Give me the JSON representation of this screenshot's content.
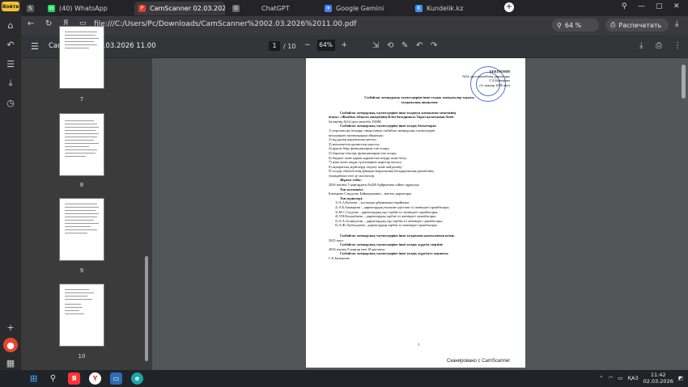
{
  "side_panel": {
    "profile_label": "Войти",
    "icons": [
      "home-icon",
      "back-icon",
      "history-icon",
      "downloads-icon",
      "clock-icon",
      "add-icon",
      "alice-icon",
      "apps-icon"
    ]
  },
  "tabs": [
    {
      "label": "",
      "favicon": "S",
      "color": "#5b5b62"
    },
    {
      "label": "(40) WhatsApp",
      "favicon": "W",
      "color": "#25d366"
    },
    {
      "label": "CamScanner 02.03.202",
      "favicon": "P",
      "color": "#e33b2e",
      "active": true
    },
    {
      "label": "ChatGPT",
      "favicon": "G",
      "color": "#6b6b6b"
    },
    {
      "label": "Google Gemini",
      "favicon": "✦",
      "color": "#4b82f5"
    },
    {
      "label": "Kundelik.kz",
      "favicon": "K",
      "color": "#3f8ef5"
    }
  ],
  "address_bar": {
    "url": "file:///C:/Users/Pc/Downloads/CamScanner%2002.03.2026%2011.00.pdf",
    "zoom": "64 %",
    "print_label": "Распечатать"
  },
  "pdf_toolbar": {
    "title": "CamScanner 02.03.2026 11.00",
    "current_page": "1",
    "total_pages": "/ 10",
    "zoom": "64%",
    "zoom_out": "−",
    "zoom_in": "+"
  },
  "thumbnails": [
    {
      "number": "7"
    },
    {
      "number": "8"
    },
    {
      "number": "9"
    },
    {
      "number": "10"
    }
  ],
  "document": {
    "approval": [
      "БЕКІТЕМІН",
      "№54 орта мектебінің директоры",
      "С.Б.Битюрова",
      "«5» қаңтар 2026 жыл"
    ],
    "title_1": "Сыбайлас жемқорлық тәуекелдеріне ішкі талдау жатқызулер туралы",
    "title_2": "талдамалық анықтама",
    "intro_1": "Сыбайлас жемқорлық тәуекелдеріне ішкі талдауға жатқызған мекеменің",
    "intro_2": "атауы: «Жамбыл облысы әкімдігінің білім басқармасы Тараз қаласының білім",
    "intro_3": "бөлімінің №54 орта мектебі» КММ.",
    "directions_heading": "Сыбайлас жемқорлық тәуекелдеріне ішкі талдау бағыттары:",
    "directions": [
      "1)    персоналды басқару, оның ішінде сыбайлас жемқорлық тәуекелдерін",
      "шалдықкан лауазымдарды айқындау;",
      "2) мүдделер қақтығысын реттеу;",
      "3) мемлекеттік қызметтер көрсету;",
      "4) рұқсат беру функцияларын іске асыру;",
      "5) бақылау-тексеру функцияларын іске асыру;",
      "6) бюджет және қаржы қаржаттын атқару және бөлу;",
      "7) жеке және заңды тұлғалармен шарттар жасасу;",
      "8) ақпараттық жүйелерді өзірлеу және пайдалану;",
      "9)    талдау    объектісінің    ұйымдастырушылық-басқарушылық    қызметінің",
      "туындайтын өзге де мәселелер."
    ],
    "group_heading": "Жұмыс тобы:",
    "group_order": "2026 жылғы 5 қаңтардағы №426 бұйрығына сәйкес құрылды.",
    "chair_heading": "Топ жетекшісі:",
    "chair": "Битюрова Сәндугаш Байкадамовна – мектеп директоры.",
    "members_heading": "Топ мүшелері:",
    "members": [
      "1)  А.А.Куатова – кәсіподақ ұйымының төрайымы;",
      "2)  А.Б.Бакиарова – директордың ғылыми-әдістеме ісі жөніндегі орынбасары;",
      "3)  М.С.Садуова – директордың оқу-тәрбие ісі жөніндегі орынбасары;",
      "4)  У.Н.Калдыбаева – директордың тәрбие ісі жөніндегі орынбасары;",
      "5)  А.А.Асанкулова – директордың оқу-тәрбие ісі жөніндегі орынбасары;",
      "6)  А.Ж.Таубалдиева - директордың тәрбие ісі жөніндегі орынбасары."
    ],
    "period_heading": "Сыбайлас жемқорлық тәуекелдеріне ішкі талдаумен қамтылатын кезең:",
    "period_value": "2025 жыл.",
    "dates_heading": "Сыбайлас жемқорлық тәуекелдеріне ішкі талдау жүргізу мерзімі:",
    "dates_value": "2026 жылғы 8 қаңтар мен 18 аралығы.",
    "resp_heading": "Сыбайлас жемқорлық тәуекелдеріне ішкі талдау жүргізуге жауапты:",
    "resp_value": "С.Б.Битюрова.",
    "page_number": "1",
    "footer": "Сканировано с CamScanner"
  },
  "taskbar": {
    "icons": [
      "start-icon",
      "search-icon",
      "yandex-music-icon",
      "yandex-browser-icon",
      "file-explorer-icon",
      "edge-icon"
    ],
    "tray": {
      "language": "ҚАЗ",
      "time": "11:42",
      "date": "02.03.2026"
    }
  }
}
